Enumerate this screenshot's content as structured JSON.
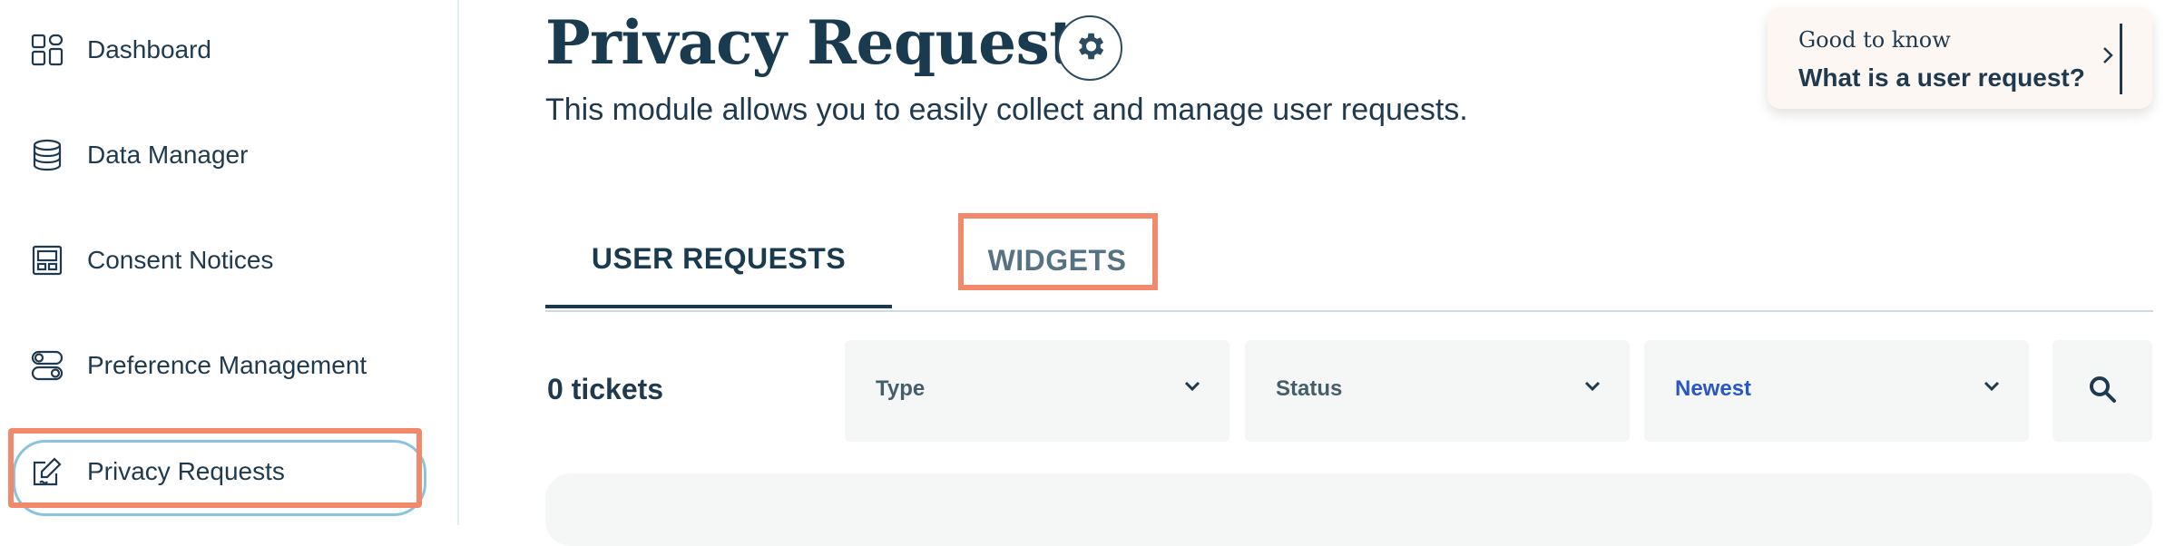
{
  "sidebar": {
    "items": [
      {
        "label": "Dashboard",
        "icon": "dashboard-icon"
      },
      {
        "label": "Data Manager",
        "icon": "database-icon"
      },
      {
        "label": "Consent Notices",
        "icon": "consent-notice-icon"
      },
      {
        "label": "Preference Management",
        "icon": "toggles-icon"
      },
      {
        "label": "Privacy Requests",
        "icon": "edit-request-icon",
        "active": true
      }
    ]
  },
  "header": {
    "title": "Privacy Requests",
    "subtitle": "This module allows you to easily collect and manage user requests."
  },
  "tip": {
    "kicker": "Good to know",
    "title": "What is a user request?"
  },
  "tabs": [
    {
      "label": "USER REQUESTS",
      "active": true
    },
    {
      "label": "WIDGETS",
      "active": false
    }
  ],
  "toolbar": {
    "tickets": "0 tickets",
    "filters": [
      {
        "label": "Type"
      },
      {
        "label": "Status"
      },
      {
        "label": "Newest"
      }
    ]
  },
  "colors": {
    "accent_highlight": "#f3896b",
    "primary_text": "#1f3a4f",
    "sort_link": "#2a56c6",
    "panel_bg": "#f5f7f7"
  }
}
